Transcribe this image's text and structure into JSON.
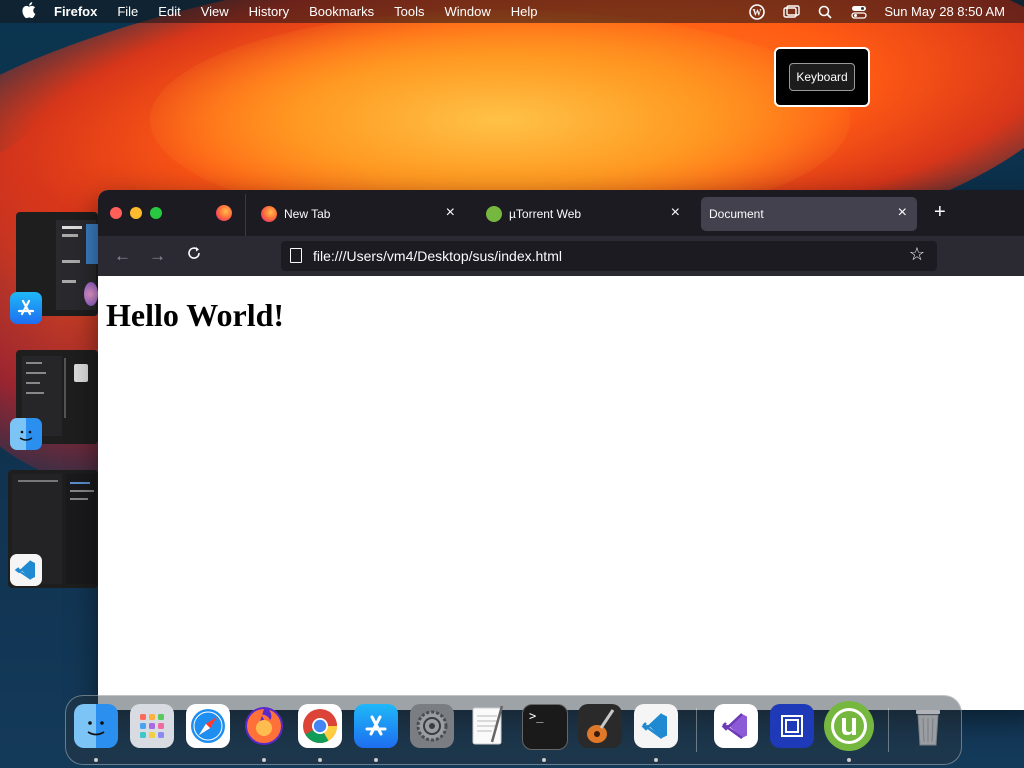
{
  "menubar": {
    "app_name": "Firefox",
    "items": [
      "File",
      "Edit",
      "View",
      "History",
      "Bookmarks",
      "Tools",
      "Window",
      "Help"
    ],
    "clock": "Sun May 28  8:50 AM"
  },
  "keyboard_overlay": {
    "label": "Keyboard"
  },
  "browser": {
    "tabs": [
      {
        "label": "New Tab",
        "active": false
      },
      {
        "label": "µTorrent Web",
        "active": false
      },
      {
        "label": "Document",
        "active": true
      }
    ],
    "url": "file:///Users/vm4/Desktop/sus/index.html",
    "content_heading": "Hello World!"
  },
  "dock": {
    "apps": [
      "finder-icon",
      "launchpad-icon",
      "safari-icon",
      "firefox-icon",
      "chrome-icon",
      "app-store-icon",
      "system-settings-icon",
      "textedit-icon",
      "terminal-icon",
      "garageband-icon",
      "vscode-icon",
      "visual-studio-icon",
      "preview-icon",
      "utorrent-icon",
      "trash-icon"
    ]
  },
  "colors": {
    "tab_active": "#42414d",
    "tabbar": "#1c1b22",
    "navbar": "#2b2a33"
  }
}
